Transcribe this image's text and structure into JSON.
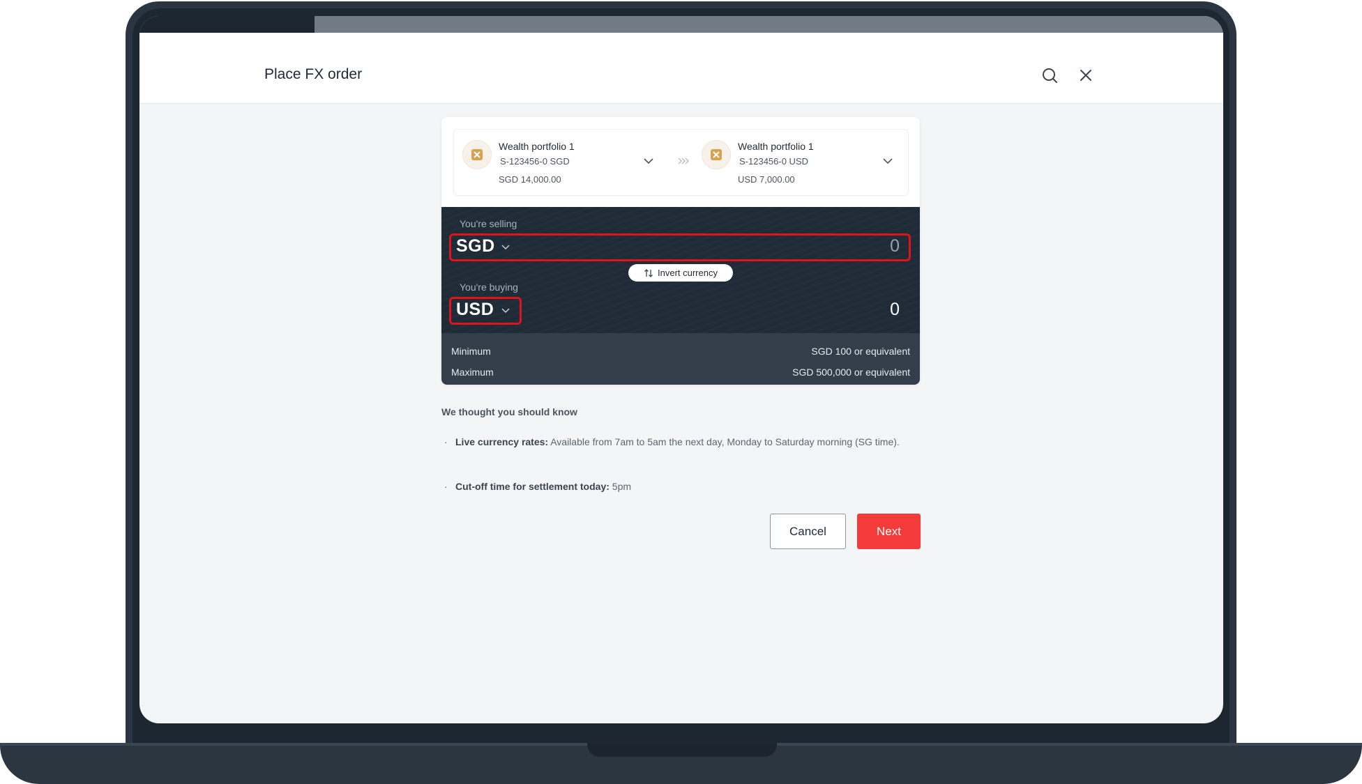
{
  "header": {
    "title": "Place FX order"
  },
  "accounts": {
    "from": {
      "name": "Wealth portfolio 1",
      "number": "S-123456-0 SGD",
      "balance": "SGD 14,000.00"
    },
    "to": {
      "name": "Wealth portfolio 1",
      "number": "S-123456-0 USD",
      "balance": "USD 7,000.00"
    }
  },
  "fx": {
    "selling_label": "You're selling",
    "selling_currency": "SGD",
    "selling_amount": "0",
    "invert_label": "Invert currency",
    "buying_label": "You're buying",
    "buying_currency": "USD",
    "buying_amount": "0"
  },
  "limits": {
    "minimum_label": "Minimum",
    "minimum_value": "SGD 100 or equivalent",
    "maximum_label": "Maximum",
    "maximum_value": "SGD 500,000 or equivalent"
  },
  "info": {
    "title": "We thought you should know",
    "items": [
      {
        "bold": "Live currency rates:",
        "text": " Available from 7am to 5am the next day, Monday to Saturday morning (SG time)."
      },
      {
        "bold": "Cut-off time for settlement today:",
        "text": " 5pm"
      }
    ]
  },
  "actions": {
    "cancel_label": "Cancel",
    "next_label": "Next"
  },
  "colors": {
    "highlight": "#e0121a",
    "next_button": "#f33b3b",
    "panel": "#1f2b36"
  }
}
